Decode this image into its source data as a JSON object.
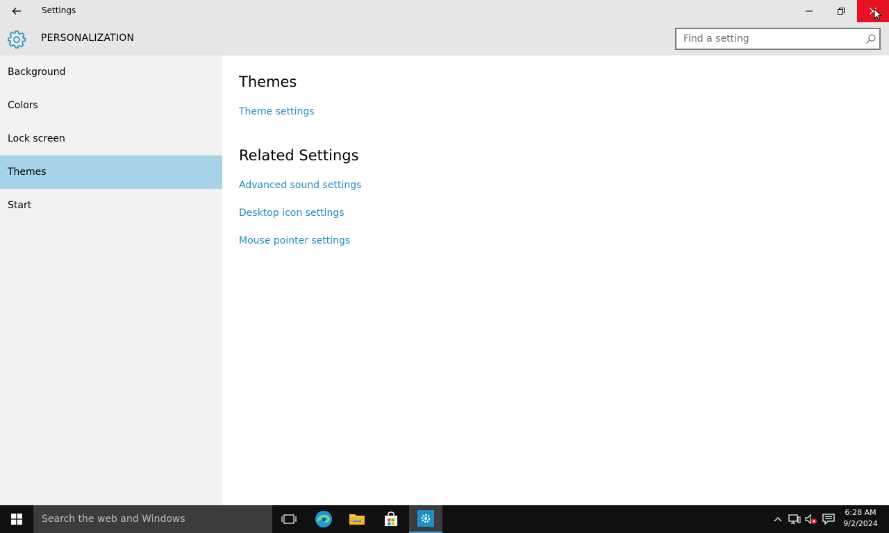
{
  "window": {
    "title": "Settings"
  },
  "header": {
    "section_title": "PERSONALIZATION",
    "search_placeholder": "Find a setting"
  },
  "sidebar": {
    "items": [
      {
        "label": "Background",
        "active": false
      },
      {
        "label": "Colors",
        "active": false
      },
      {
        "label": "Lock screen",
        "active": false
      },
      {
        "label": "Themes",
        "active": true
      },
      {
        "label": "Start",
        "active": false
      }
    ]
  },
  "content": {
    "themes_heading": "Themes",
    "theme_settings_link": "Theme settings",
    "related_heading": "Related Settings",
    "related_links": [
      "Advanced sound settings",
      "Desktop icon settings",
      "Mouse pointer settings"
    ]
  },
  "taskbar": {
    "search_placeholder": "Search the web and Windows",
    "time": "6:28 AM",
    "date": "9/2/2024"
  },
  "colors": {
    "accent": "#1f8cbf",
    "active_nav": "#a6d3e8",
    "close_button": "#e81123"
  }
}
